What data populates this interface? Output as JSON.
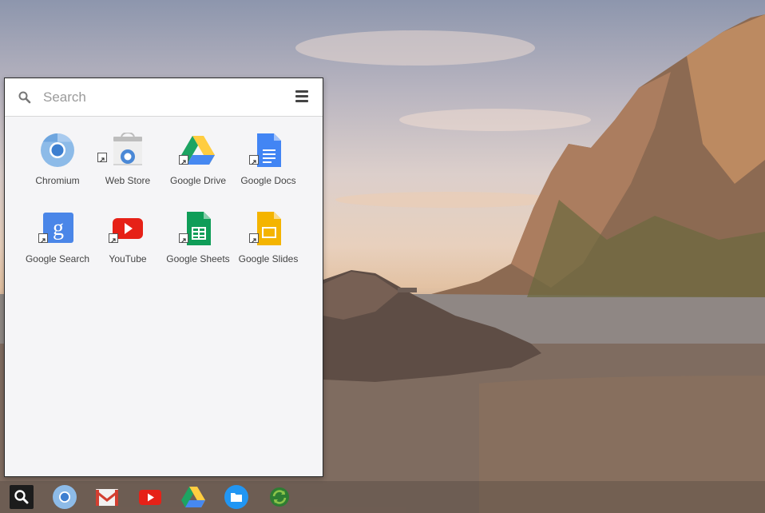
{
  "search": {
    "placeholder": "Search"
  },
  "menu": {
    "icon": "hamburger-menu-icon"
  },
  "apps": [
    {
      "label": "Chromium",
      "icon": "chromium-icon",
      "shortcut": false
    },
    {
      "label": "Web Store",
      "icon": "web-store-icon",
      "shortcut": true
    },
    {
      "label": "Google Drive",
      "icon": "google-drive-icon",
      "shortcut": true
    },
    {
      "label": "Google Docs",
      "icon": "google-docs-icon",
      "shortcut": true
    },
    {
      "label": "Google Search",
      "icon": "google-search-icon",
      "shortcut": true
    },
    {
      "label": "YouTube",
      "icon": "youtube-icon",
      "shortcut": true
    },
    {
      "label": "Google Sheets",
      "icon": "google-sheets-icon",
      "shortcut": true
    },
    {
      "label": "Google Slides",
      "icon": "google-slides-icon",
      "shortcut": true
    }
  ],
  "shelf": [
    {
      "icon": "app-launcher-search-icon"
    },
    {
      "icon": "chromium-icon"
    },
    {
      "icon": "gmail-icon"
    },
    {
      "icon": "youtube-icon"
    },
    {
      "icon": "google-drive-icon"
    },
    {
      "icon": "files-icon"
    },
    {
      "icon": "sync-icon"
    }
  ],
  "colors": {
    "drive_green": "#1da462",
    "drive_yellow": "#ffcd40",
    "drive_blue": "#4688f1",
    "docs_blue": "#4285f4",
    "sheets_green": "#0f9d58",
    "slides_yellow": "#f4b400",
    "youtube_red": "#e62117",
    "launcher_bg": "#f5f5f7"
  }
}
